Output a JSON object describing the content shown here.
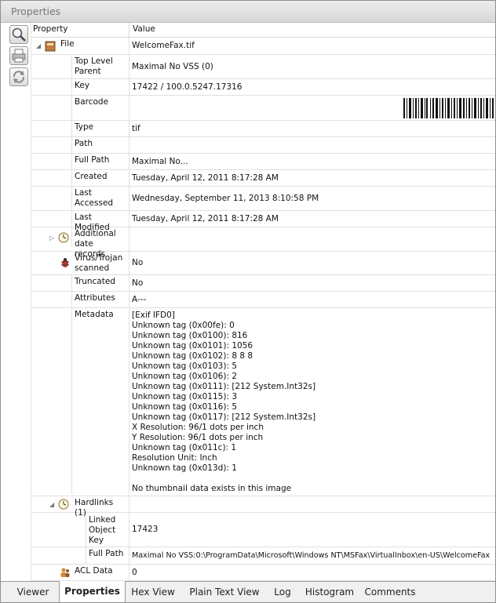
{
  "window": {
    "title": "Properties"
  },
  "toolbar": [
    {
      "name": "zoom-tool",
      "icon": "magnifier-icon"
    },
    {
      "name": "print-tool",
      "icon": "printer-icon"
    },
    {
      "name": "refresh-tool",
      "icon": "refresh-icon"
    }
  ],
  "columns": {
    "property": "Property",
    "value": "Value"
  },
  "rows": {
    "file": {
      "label": "File",
      "value": "WelcomeFax.tif",
      "icon": "file-icon"
    },
    "top_level_parent": {
      "label": "Top Level Parent",
      "value": "Maximal No VSS (0)"
    },
    "key": {
      "label": "Key",
      "value": "17422 / 100.0.5247.17316"
    },
    "barcode": {
      "label": "Barcode",
      "value": ""
    },
    "type": {
      "label": "Type",
      "value": "tif"
    },
    "path": {
      "label": "Path",
      "value": ""
    },
    "full_path": {
      "label": "Full Path",
      "value": "Maximal No..."
    },
    "created": {
      "label": "Created",
      "value": "Tuesday, April 12, 2011 8:17:28 AM"
    },
    "last_accessed": {
      "label": "Last Accessed",
      "value": "Wednesday, September 11, 2013 8:10:58 PM"
    },
    "last_modified": {
      "label": "Last Modified",
      "value": "Tuesday, April 12, 2011 8:17:28 AM"
    },
    "additional_dates": {
      "label": "Additional date records",
      "value": "",
      "icon": "clock-icon"
    },
    "virus_scanned": {
      "label": "Virus/Trojan scanned",
      "value": "No",
      "icon": "bug-icon"
    },
    "truncated": {
      "label": "Truncated",
      "value": "No"
    },
    "attributes": {
      "label": "Attributes",
      "value": "A---"
    },
    "metadata": {
      "label": "Metadata",
      "lines": [
        "[Exif IFD0]",
        "Unknown tag (0x00fe): 0",
        "Unknown tag (0x0100): 816",
        "Unknown tag (0x0101): 1056",
        "Unknown tag (0x0102): 8 8 8",
        "Unknown tag (0x0103): 5",
        "Unknown tag (0x0106): 2",
        "Unknown tag (0x0111): [212 System.Int32s]",
        "Unknown tag (0x0115): 3",
        "Unknown tag (0x0116): 5",
        "Unknown tag (0x0117): [212 System.Int32s]",
        "X Resolution: 96/1 dots per inch",
        "Y Resolution: 96/1 dots per inch",
        "Unknown tag (0x011c): 1",
        "Resolution Unit: Inch",
        "Unknown tag (0x013d): 1",
        "",
        "No thumbnail data exists in this image"
      ]
    },
    "hardlinks": {
      "label": "Hardlinks (1)",
      "value": "",
      "icon": "clock-icon"
    },
    "linked_object_key": {
      "label": "Linked Object Key",
      "value": "17423"
    },
    "hardlink_full_path": {
      "label": "Full Path",
      "value": "Maximal No VSS:0:\\ProgramData\\Microsoft\\Windows NT\\MSFax\\VirtualInbox\\en-US\\WelcomeFax"
    },
    "acl_data": {
      "label": "ACL Data",
      "value": "0",
      "icon": "users-icon"
    }
  },
  "tabs": [
    {
      "label": "Viewer",
      "active": false
    },
    {
      "label": "Properties",
      "active": true
    },
    {
      "label": "Hex View",
      "active": false
    },
    {
      "label": "Plain Text View",
      "active": false
    },
    {
      "label": "Log",
      "active": false
    },
    {
      "label": "Histogram",
      "active": false
    },
    {
      "label": "Comments",
      "active": false
    }
  ]
}
